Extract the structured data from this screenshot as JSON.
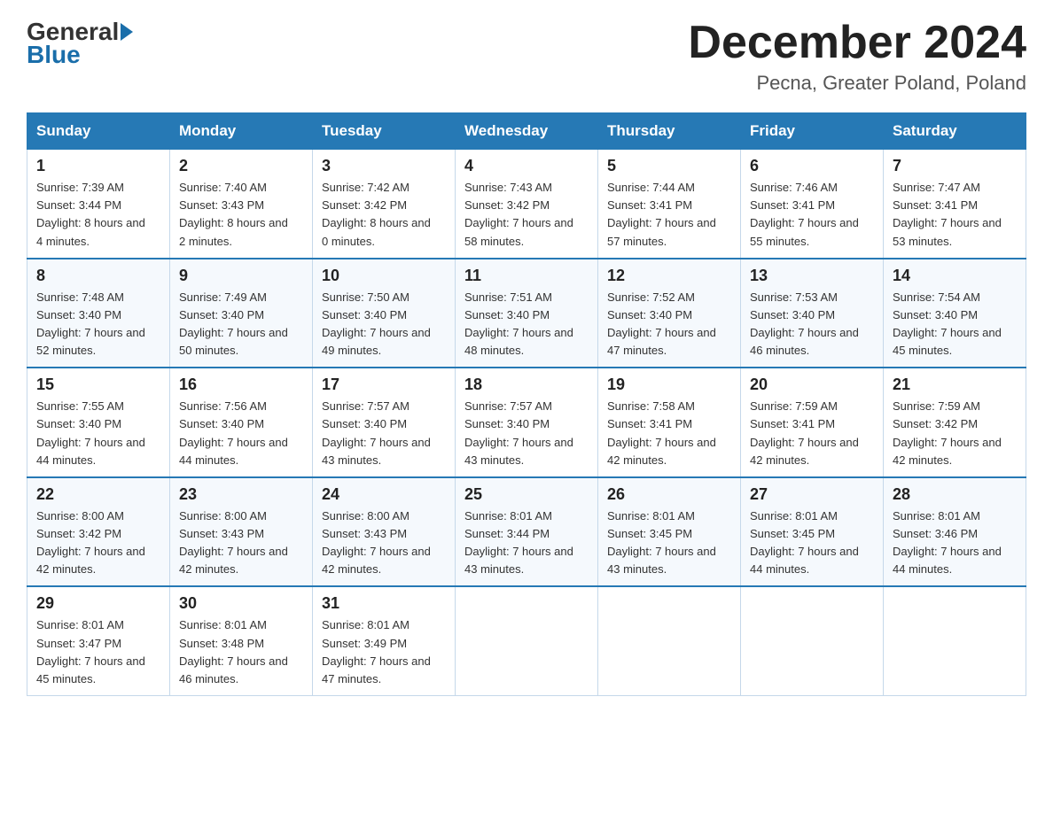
{
  "logo": {
    "general": "General",
    "blue": "Blue"
  },
  "title": {
    "month": "December 2024",
    "location": "Pecna, Greater Poland, Poland"
  },
  "weekdays": [
    "Sunday",
    "Monday",
    "Tuesday",
    "Wednesday",
    "Thursday",
    "Friday",
    "Saturday"
  ],
  "weeks": [
    [
      {
        "day": "1",
        "sunrise": "7:39 AM",
        "sunset": "3:44 PM",
        "daylight": "8 hours and 4 minutes."
      },
      {
        "day": "2",
        "sunrise": "7:40 AM",
        "sunset": "3:43 PM",
        "daylight": "8 hours and 2 minutes."
      },
      {
        "day": "3",
        "sunrise": "7:42 AM",
        "sunset": "3:42 PM",
        "daylight": "8 hours and 0 minutes."
      },
      {
        "day": "4",
        "sunrise": "7:43 AM",
        "sunset": "3:42 PM",
        "daylight": "7 hours and 58 minutes."
      },
      {
        "day": "5",
        "sunrise": "7:44 AM",
        "sunset": "3:41 PM",
        "daylight": "7 hours and 57 minutes."
      },
      {
        "day": "6",
        "sunrise": "7:46 AM",
        "sunset": "3:41 PM",
        "daylight": "7 hours and 55 minutes."
      },
      {
        "day": "7",
        "sunrise": "7:47 AM",
        "sunset": "3:41 PM",
        "daylight": "7 hours and 53 minutes."
      }
    ],
    [
      {
        "day": "8",
        "sunrise": "7:48 AM",
        "sunset": "3:40 PM",
        "daylight": "7 hours and 52 minutes."
      },
      {
        "day": "9",
        "sunrise": "7:49 AM",
        "sunset": "3:40 PM",
        "daylight": "7 hours and 50 minutes."
      },
      {
        "day": "10",
        "sunrise": "7:50 AM",
        "sunset": "3:40 PM",
        "daylight": "7 hours and 49 minutes."
      },
      {
        "day": "11",
        "sunrise": "7:51 AM",
        "sunset": "3:40 PM",
        "daylight": "7 hours and 48 minutes."
      },
      {
        "day": "12",
        "sunrise": "7:52 AM",
        "sunset": "3:40 PM",
        "daylight": "7 hours and 47 minutes."
      },
      {
        "day": "13",
        "sunrise": "7:53 AM",
        "sunset": "3:40 PM",
        "daylight": "7 hours and 46 minutes."
      },
      {
        "day": "14",
        "sunrise": "7:54 AM",
        "sunset": "3:40 PM",
        "daylight": "7 hours and 45 minutes."
      }
    ],
    [
      {
        "day": "15",
        "sunrise": "7:55 AM",
        "sunset": "3:40 PM",
        "daylight": "7 hours and 44 minutes."
      },
      {
        "day": "16",
        "sunrise": "7:56 AM",
        "sunset": "3:40 PM",
        "daylight": "7 hours and 44 minutes."
      },
      {
        "day": "17",
        "sunrise": "7:57 AM",
        "sunset": "3:40 PM",
        "daylight": "7 hours and 43 minutes."
      },
      {
        "day": "18",
        "sunrise": "7:57 AM",
        "sunset": "3:40 PM",
        "daylight": "7 hours and 43 minutes."
      },
      {
        "day": "19",
        "sunrise": "7:58 AM",
        "sunset": "3:41 PM",
        "daylight": "7 hours and 42 minutes."
      },
      {
        "day": "20",
        "sunrise": "7:59 AM",
        "sunset": "3:41 PM",
        "daylight": "7 hours and 42 minutes."
      },
      {
        "day": "21",
        "sunrise": "7:59 AM",
        "sunset": "3:42 PM",
        "daylight": "7 hours and 42 minutes."
      }
    ],
    [
      {
        "day": "22",
        "sunrise": "8:00 AM",
        "sunset": "3:42 PM",
        "daylight": "7 hours and 42 minutes."
      },
      {
        "day": "23",
        "sunrise": "8:00 AM",
        "sunset": "3:43 PM",
        "daylight": "7 hours and 42 minutes."
      },
      {
        "day": "24",
        "sunrise": "8:00 AM",
        "sunset": "3:43 PM",
        "daylight": "7 hours and 42 minutes."
      },
      {
        "day": "25",
        "sunrise": "8:01 AM",
        "sunset": "3:44 PM",
        "daylight": "7 hours and 43 minutes."
      },
      {
        "day": "26",
        "sunrise": "8:01 AM",
        "sunset": "3:45 PM",
        "daylight": "7 hours and 43 minutes."
      },
      {
        "day": "27",
        "sunrise": "8:01 AM",
        "sunset": "3:45 PM",
        "daylight": "7 hours and 44 minutes."
      },
      {
        "day": "28",
        "sunrise": "8:01 AM",
        "sunset": "3:46 PM",
        "daylight": "7 hours and 44 minutes."
      }
    ],
    [
      {
        "day": "29",
        "sunrise": "8:01 AM",
        "sunset": "3:47 PM",
        "daylight": "7 hours and 45 minutes."
      },
      {
        "day": "30",
        "sunrise": "8:01 AM",
        "sunset": "3:48 PM",
        "daylight": "7 hours and 46 minutes."
      },
      {
        "day": "31",
        "sunrise": "8:01 AM",
        "sunset": "3:49 PM",
        "daylight": "7 hours and 47 minutes."
      },
      null,
      null,
      null,
      null
    ]
  ]
}
